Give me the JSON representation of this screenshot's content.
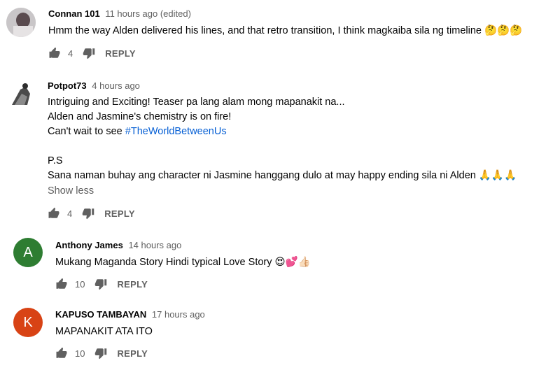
{
  "comments": [
    {
      "author": "Connan 101",
      "time": "11 hours ago (edited)",
      "lines": [
        "Hmm the way Alden delivered his lines, and that retro transition, I think magkaiba sila ng timeline 🤔🤔🤔"
      ],
      "likes": "4",
      "reply": "REPLY"
    },
    {
      "author": "Potpot73",
      "time": "4 hours ago",
      "lines": [
        "Intriguing and Exciting! Teaser pa lang alam mong mapanakit na...",
        "Alden and Jasmine's chemistry is on fire!",
        "Can't wait to see ",
        "",
        "P.S",
        "Sana naman buhay ang character ni Jasmine hanggang dulo at may happy ending sila ni Alden 🙏🙏🙏"
      ],
      "hashtag": "#TheWorldBetweenUs",
      "show_less": "Show less",
      "likes": "4",
      "reply": "REPLY"
    },
    {
      "author": "Anthony James",
      "time": "14 hours ago",
      "avatar_letter": "A",
      "avatar_color": "#2e7d32",
      "lines": [
        "Mukang Maganda Story Hindi typical Love Story 😍💕👍🏻"
      ],
      "likes": "10",
      "reply": "REPLY"
    },
    {
      "author": "KAPUSO TAMBAYAN",
      "time": "17 hours ago",
      "avatar_letter": "K",
      "avatar_color": "#d84315",
      "lines": [
        "MAPANAKIT ATA ITO"
      ],
      "likes": "10",
      "reply": "REPLY"
    }
  ]
}
